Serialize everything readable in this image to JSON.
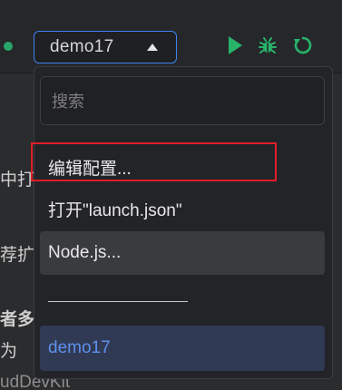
{
  "toolbar": {
    "config_name": "demo17",
    "run_icon": "play-icon",
    "debug_icon": "bug-icon",
    "restart_icon": "restart-icon"
  },
  "background_text": [
    {
      "text": "中打"
    },
    {
      "text": "荐扩"
    },
    {
      "text": "者多"
    },
    {
      "text": "为"
    },
    {
      "text": "udDevKit"
    }
  ],
  "dropdown": {
    "search_placeholder": "搜索",
    "items": [
      {
        "label": "编辑配置..."
      },
      {
        "label": "打开\"launch.json\""
      },
      {
        "label": "Node.js..."
      },
      {
        "label": "demo17"
      }
    ]
  },
  "colors": {
    "accent": "#3d84f0",
    "run": "#27b36a",
    "highlight_border": "#e11d25",
    "selected_text": "#5d90ec"
  }
}
